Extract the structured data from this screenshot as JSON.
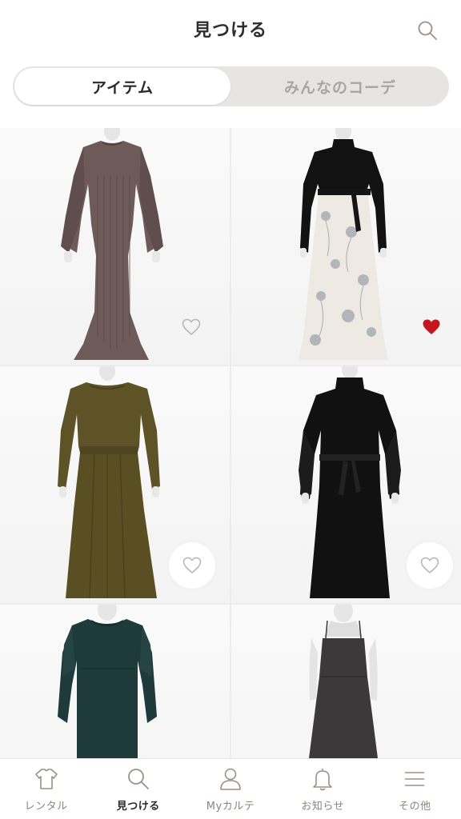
{
  "header": {
    "title": "見つける",
    "search_icon": "search-icon"
  },
  "segment": {
    "tabs": [
      {
        "label": "アイテム",
        "active": true
      },
      {
        "label": "みんなのコーデ",
        "active": false
      }
    ]
  },
  "items": [
    {
      "name": "mauve rib knit mermaid dress",
      "favorited": false
    },
    {
      "name": "black knit top floral skirt dress",
      "favorited": true
    },
    {
      "name": "olive long-sleeve pleated dress",
      "favorited": false
    },
    {
      "name": "black high-neck belted dress",
      "favorited": false
    },
    {
      "name": "dark green puff-sleeve dress",
      "favorited": false
    },
    {
      "name": "charcoal camisole dress",
      "favorited": false
    }
  ],
  "bottom_nav": {
    "items": [
      {
        "label": "レンタル",
        "icon": "shirt-icon",
        "active": false
      },
      {
        "label": "見つける",
        "icon": "search-icon",
        "active": true
      },
      {
        "label": "Myカルテ",
        "icon": "person-icon",
        "active": false
      },
      {
        "label": "お知らせ",
        "icon": "bell-icon",
        "active": false
      },
      {
        "label": "その他",
        "icon": "menu-icon",
        "active": false
      }
    ]
  },
  "colors": {
    "favorite": "#c4161c",
    "nav_icon": "#9b9086",
    "segment_bg": "#e6e5e3"
  }
}
